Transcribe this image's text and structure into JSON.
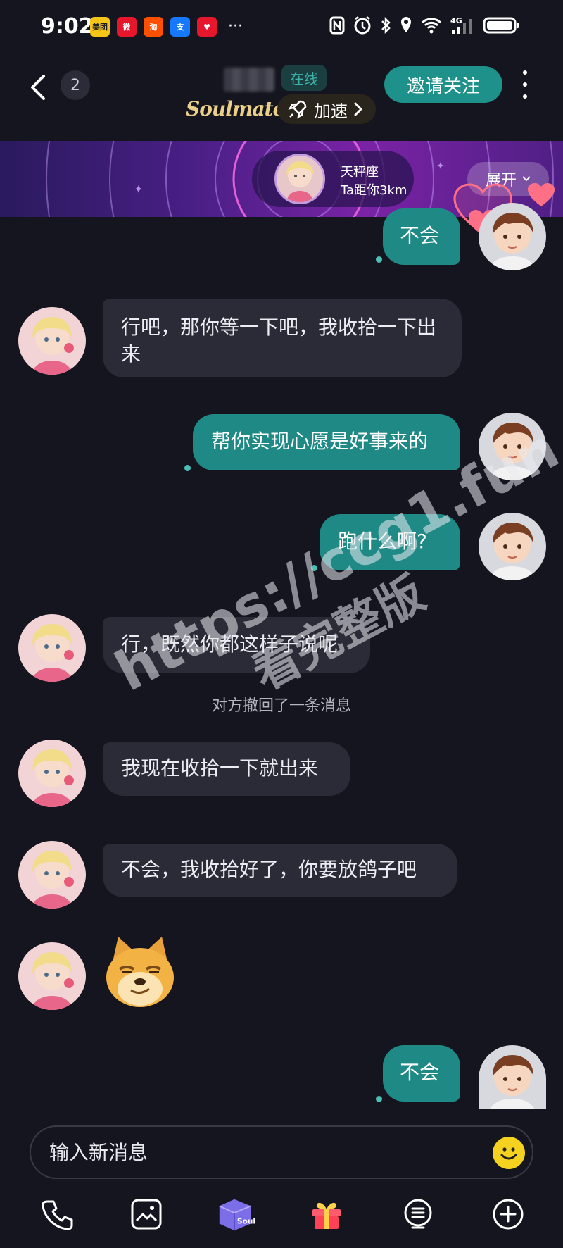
{
  "status_bar": {
    "time": "9:02",
    "apps": [
      {
        "name": "meituan-icon",
        "text": "美团",
        "color": "#f5c518"
      },
      {
        "name": "weibo-icon",
        "text": "微",
        "color": "#e6162d"
      },
      {
        "name": "taobao-icon",
        "text": "淘",
        "color": "#ff5000"
      },
      {
        "name": "alipay-icon",
        "text": "支",
        "color": "#1677ff"
      },
      {
        "name": "heart-app-icon",
        "text": "♥",
        "color": "#e6162d"
      }
    ],
    "more": "···",
    "network": "4G"
  },
  "header": {
    "unread_count": "2",
    "online_label": "在线",
    "brand": "Soulmate",
    "boost_label": "加速",
    "invite_label": "邀请关注"
  },
  "banner": {
    "zodiac": "天秤座",
    "distance": "Ta距你3km",
    "expand_label": "展开"
  },
  "messages": [
    {
      "side": "out",
      "text": "不会"
    },
    {
      "side": "in",
      "text": "行吧，那你等一下吧，我收拾一下出来"
    },
    {
      "side": "out",
      "text": "帮你实现心愿是好事来的"
    },
    {
      "side": "out",
      "text": "跑什么啊?"
    },
    {
      "side": "in",
      "text": "行，既然你都这样子说呢"
    },
    {
      "side": "in",
      "text": "我现在收拾一下就出来"
    },
    {
      "side": "in",
      "text": "不会，我收拾好了，你要放鸽子吧"
    },
    {
      "side": "in",
      "type": "sticker",
      "sticker": "doge-smirk-sticker"
    },
    {
      "side": "out",
      "text": "不会"
    }
  ],
  "recall_notice": "对方撤回了一条消息",
  "watermark": {
    "line1": "https://ccg1.fun",
    "line2": "看完整版"
  },
  "composer": {
    "placeholder": "输入新消息"
  },
  "toolbar": {
    "items": [
      "phone-icon",
      "image-icon",
      "soul-box-icon",
      "gift-icon",
      "voice-icon",
      "add-icon"
    ],
    "soul_box_label": "Soul"
  },
  "colors": {
    "background": "#15151f",
    "bubble_in": "#2b2b37",
    "bubble_out": "#1f8a85",
    "accent": "#1f918b",
    "brand_gold": "#e9cf87"
  }
}
